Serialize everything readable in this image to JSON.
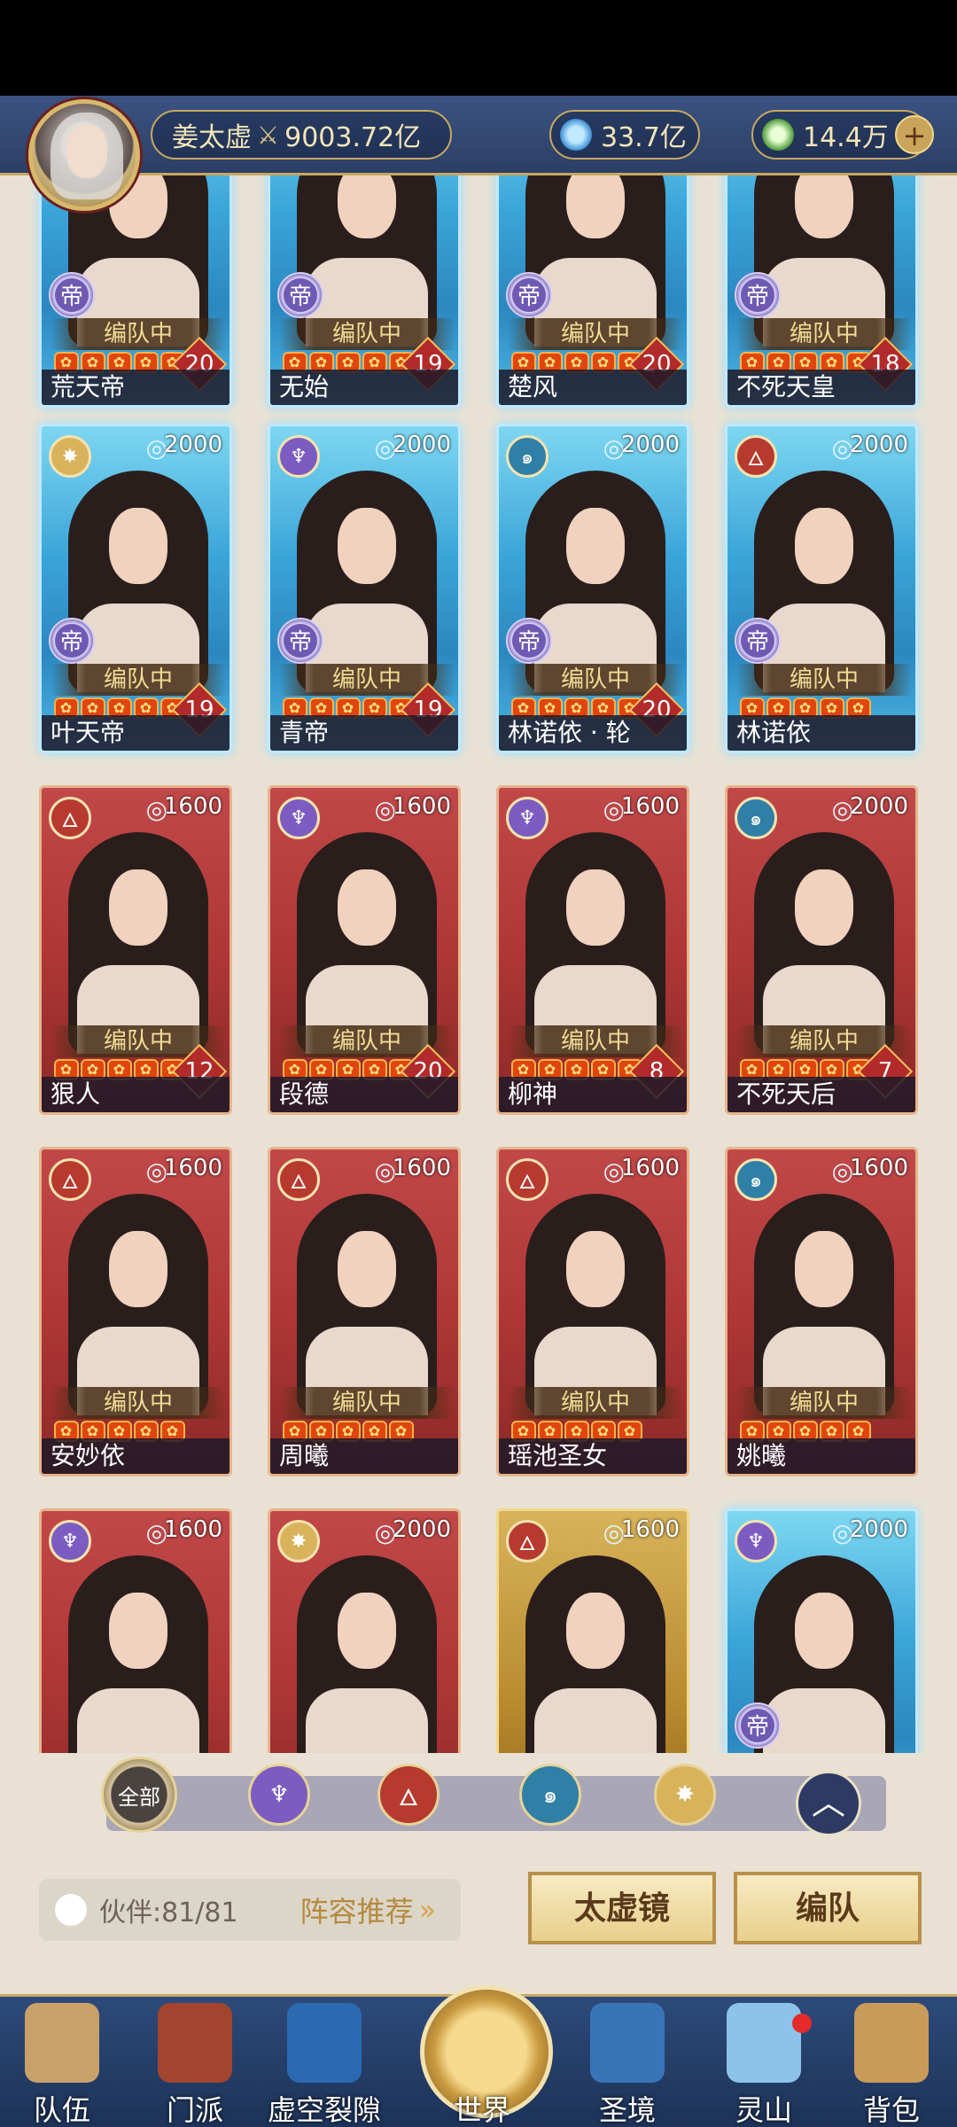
{
  "player": {
    "name": "姜太虚",
    "power": "9003.72亿",
    "crystals": "33.7亿",
    "jade": "14.4万"
  },
  "cards": [
    {
      "name": "荒天帝",
      "power": "",
      "element": "",
      "level": "20",
      "team": "编队中",
      "emperor": true,
      "style": "blue"
    },
    {
      "name": "无始",
      "power": "",
      "element": "",
      "level": "19",
      "team": "编队中",
      "emperor": true,
      "style": "blue"
    },
    {
      "name": "楚风",
      "power": "",
      "element": "",
      "level": "20",
      "team": "编队中",
      "emperor": true,
      "style": "blue"
    },
    {
      "name": "不死天皇",
      "power": "",
      "element": "",
      "level": "18",
      "team": "编队中",
      "emperor": true,
      "style": "blue"
    },
    {
      "name": "叶天帝",
      "power": "2000",
      "element": "light",
      "level": "19",
      "team": "编队中",
      "emperor": true,
      "style": "blue"
    },
    {
      "name": "青帝",
      "power": "2000",
      "element": "void",
      "level": "19",
      "team": "编队中",
      "emperor": true,
      "style": "blue"
    },
    {
      "name": "林诺依 · 轮",
      "power": "2000",
      "element": "water",
      "level": "20",
      "team": "编队中",
      "emperor": true,
      "style": "blue"
    },
    {
      "name": "林诺依",
      "power": "2000",
      "element": "fire",
      "level": "",
      "team": "编队中",
      "emperor": true,
      "style": "blue"
    },
    {
      "name": "狠人",
      "power": "1600",
      "element": "fire",
      "level": "12",
      "team": "编队中",
      "emperor": false,
      "style": "red"
    },
    {
      "name": "段德",
      "power": "1600",
      "element": "void",
      "level": "20",
      "team": "编队中",
      "emperor": false,
      "style": "red"
    },
    {
      "name": "柳神",
      "power": "1600",
      "element": "void",
      "level": "8",
      "team": "编队中",
      "emperor": false,
      "style": "red"
    },
    {
      "name": "不死天后",
      "power": "2000",
      "element": "water",
      "level": "7",
      "team": "编队中",
      "emperor": false,
      "style": "red"
    },
    {
      "name": "安妙依",
      "power": "1600",
      "element": "fire",
      "level": "",
      "team": "编队中",
      "emperor": false,
      "style": "red"
    },
    {
      "name": "周曦",
      "power": "1600",
      "element": "fire",
      "level": "",
      "team": "编队中",
      "emperor": false,
      "style": "red"
    },
    {
      "name": "瑶池圣女",
      "power": "1600",
      "element": "fire",
      "level": "",
      "team": "编队中",
      "emperor": false,
      "style": "red"
    },
    {
      "name": "姚曦",
      "power": "1600",
      "element": "water",
      "level": "",
      "team": "编队中",
      "emperor": false,
      "style": "red"
    },
    {
      "name": "",
      "power": "1600",
      "element": "void",
      "level": "",
      "team": "",
      "emperor": false,
      "style": "red"
    },
    {
      "name": "",
      "power": "2000",
      "element": "light",
      "level": "",
      "team": "",
      "emperor": false,
      "style": "red"
    },
    {
      "name": "",
      "power": "1600",
      "element": "fire",
      "level": "",
      "team": "",
      "emperor": false,
      "style": "gold"
    },
    {
      "name": "",
      "power": "2000",
      "element": "void",
      "level": "",
      "team": "",
      "emperor": true,
      "style": "blue"
    }
  ],
  "filters": {
    "all_label": "全部",
    "elements": [
      "void",
      "fire",
      "water",
      "light"
    ]
  },
  "partner": {
    "label": "伙伴:81/81",
    "recommend": "阵容推荐"
  },
  "buttons": {
    "mirror": "太虚镜",
    "team": "编队"
  },
  "nav": [
    {
      "label": "队伍"
    },
    {
      "label": "门派"
    },
    {
      "label": "虚空裂隙"
    },
    {
      "label": "世界"
    },
    {
      "label": "圣境"
    },
    {
      "label": "灵山"
    },
    {
      "label": "背包"
    }
  ],
  "glyphs": {
    "emperor": "帝",
    "star": "✿"
  },
  "colors": {
    "element_void": "#7c5cc0",
    "element_fire": "#b73a2e",
    "element_water": "#2f7fa6",
    "element_light": "#d9b35c"
  }
}
